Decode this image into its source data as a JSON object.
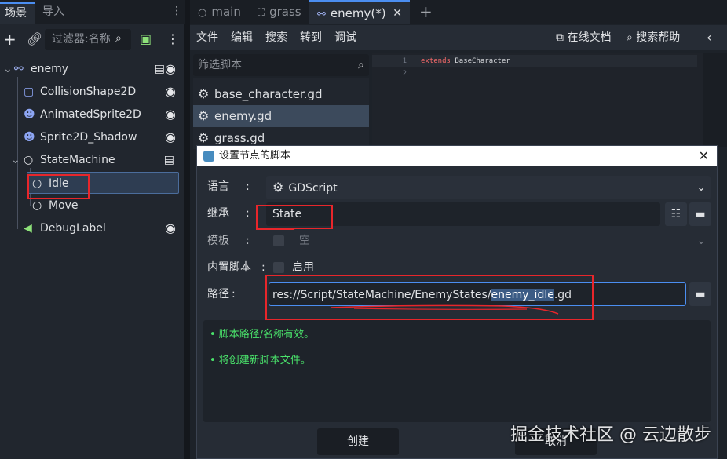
{
  "left_dock": {
    "tabs": [
      "场景",
      "导入"
    ],
    "filter_placeholder": "过滤器:名称",
    "tree": [
      {
        "name": "enemy"
      },
      {
        "name": "CollisionShape2D"
      },
      {
        "name": "AnimatedSprite2D"
      },
      {
        "name": "Sprite2D_Shadow"
      },
      {
        "name": "StateMachine"
      },
      {
        "name": "Idle"
      },
      {
        "name": "Move"
      },
      {
        "name": "DebugLabel"
      }
    ]
  },
  "editor": {
    "tabs": [
      "main",
      "grass",
      "enemy(*)"
    ],
    "menu": [
      "文件",
      "编辑",
      "搜索",
      "转到",
      "调试"
    ],
    "online_docs": "在线文档",
    "search_help": "搜索帮助",
    "script_filter_placeholder": "筛选脚本",
    "scripts": [
      "base_character.gd",
      "enemy.gd",
      "grass.gd"
    ],
    "code": [
      {
        "num": "1",
        "keyword": "extends",
        "ident": "BaseCharacter"
      },
      {
        "num": "2",
        "keyword": "",
        "ident": ""
      }
    ]
  },
  "dialog": {
    "title": "设置节点的脚本",
    "language_label": "语言",
    "language_value": "GDScript",
    "inherit_label": "继承",
    "inherit_value": "State",
    "template_label": "模板",
    "template_value": "空",
    "builtin_label": "内置脚本",
    "builtin_value": "启用",
    "path_label": "路径",
    "path_prefix": "res://Script/StateMachine/EnemyStates/",
    "path_selected": "enemy_idle",
    "path_suffix": ".gd",
    "status": [
      "• 脚本路径/名称有效。",
      "• 将创建新脚本文件。"
    ],
    "create_button": "创建",
    "cancel_button": "取消"
  },
  "watermark": "掘金技术社区 @ 云边散步",
  "colors": {
    "accent": "#4b8ef1",
    "valid": "#4ae36b",
    "annotation": "#e8262b"
  }
}
